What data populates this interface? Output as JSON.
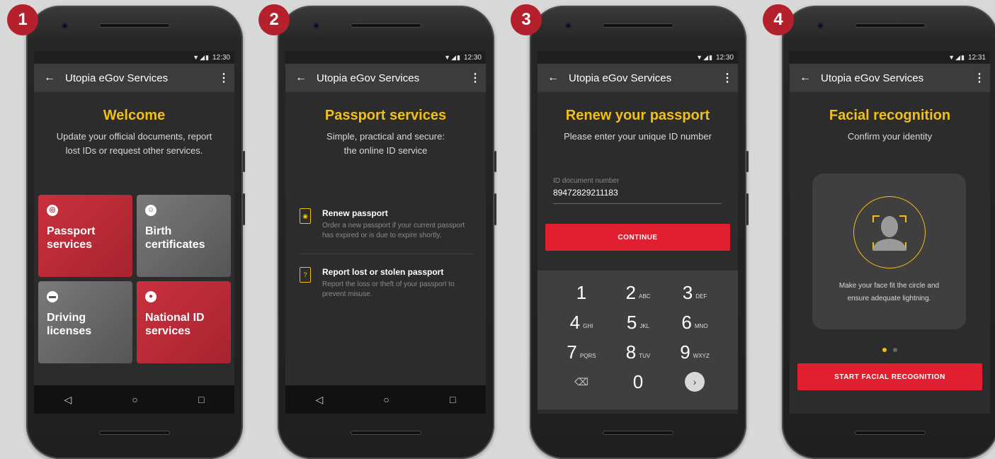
{
  "status": {
    "time_1": "12:30",
    "time_2": "12:30",
    "time_3": "12:30",
    "time_4": "12:31"
  },
  "app_title": "Utopia eGov Services",
  "steps": [
    "1",
    "2",
    "3",
    "4"
  ],
  "screen1": {
    "heading": "Welcome",
    "subtitle": "Update your official documents, report\nlost IDs or request other services.",
    "tiles": [
      {
        "label": "Passport\nservices",
        "icon": "globe-icon"
      },
      {
        "label": "Birth\ncertificates",
        "icon": "baby-icon"
      },
      {
        "label": "Driving\nlicenses",
        "icon": "car-icon"
      },
      {
        "label": "National ID\nservices",
        "icon": "person-icon"
      }
    ]
  },
  "screen2": {
    "heading": "Passport services",
    "subtitle": "Simple, practical and secure:\nthe online ID service",
    "items": [
      {
        "title": "Renew passport",
        "desc": "Order a new passport if your current passport has expired or is due to expire shortly."
      },
      {
        "title": "Report lost or stolen passport",
        "desc": "Report the loss or theft of your passport to prevent misuse."
      }
    ]
  },
  "screen3": {
    "heading": "Renew your passport",
    "subtitle": "Please enter your unique ID number",
    "field_label": "ID document number",
    "field_value": "89472829211183",
    "button": "CONTINUE",
    "keys": [
      {
        "n": "1",
        "l": ""
      },
      {
        "n": "2",
        "l": "ABC"
      },
      {
        "n": "3",
        "l": "DEF"
      },
      {
        "n": "4",
        "l": "GHI"
      },
      {
        "n": "5",
        "l": "JKL"
      },
      {
        "n": "6",
        "l": "MNO"
      },
      {
        "n": "7",
        "l": "PQRS"
      },
      {
        "n": "8",
        "l": "TUV"
      },
      {
        "n": "9",
        "l": "WXYZ"
      }
    ],
    "key_zero": "0"
  },
  "screen4": {
    "heading": "Facial recognition",
    "subtitle": "Confirm your identity",
    "card_text": "Make your face fit the circle and\nensure adequate lightning.",
    "button": "START FACIAL RECOGNITION"
  },
  "colors": {
    "accent": "#f2c014",
    "brand_red": "#e02030",
    "badge": "#b5202d"
  }
}
